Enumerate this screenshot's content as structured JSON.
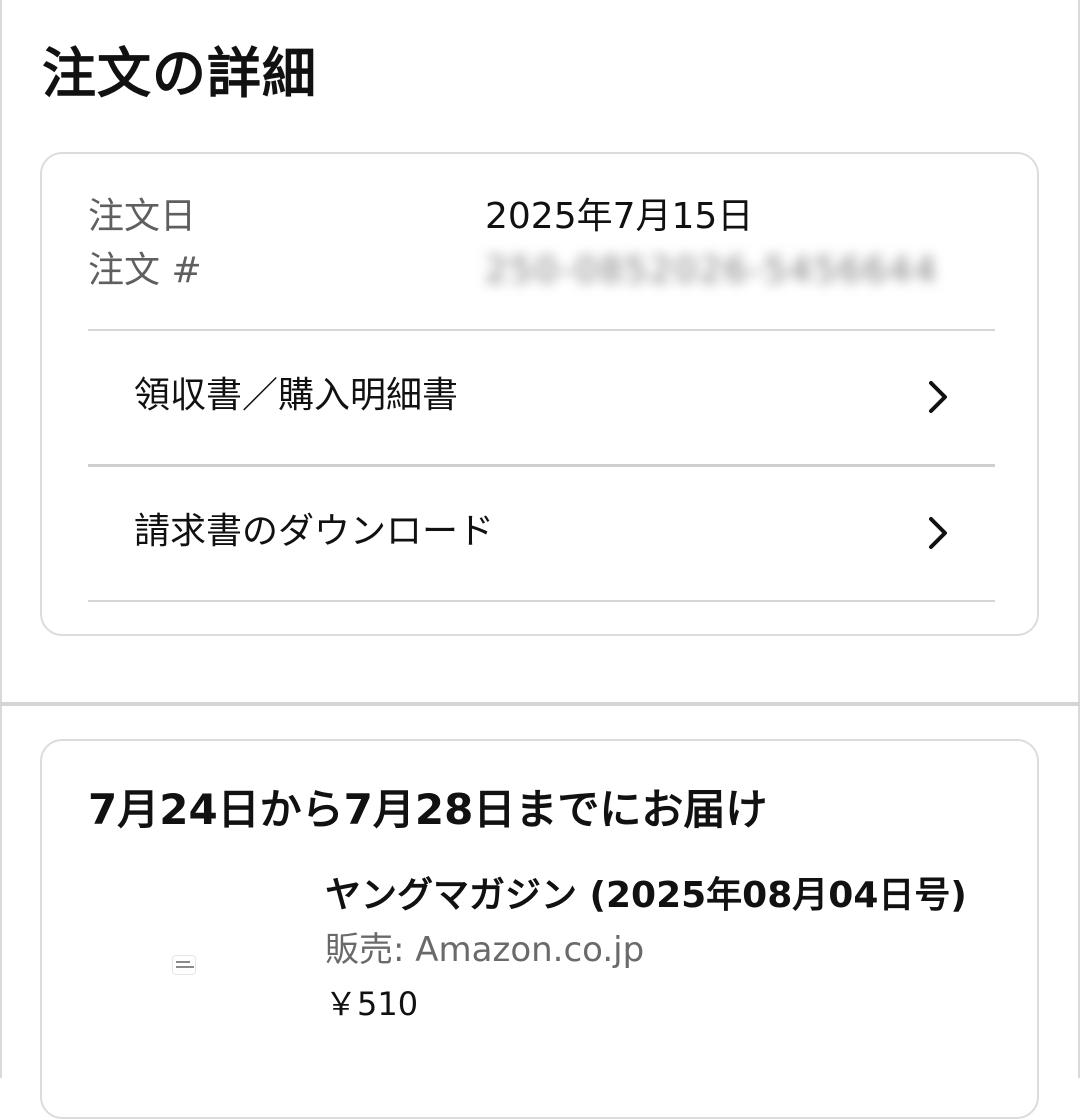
{
  "page": {
    "title": "注文の詳細"
  },
  "order_details": {
    "date_label": "注文日",
    "date_value": "2025年7月15日",
    "number_label": "注文 #",
    "number_value": "250-0852026-5456644"
  },
  "links": [
    {
      "label": "領収書／購入明細書",
      "icon": "chevron-right-icon"
    },
    {
      "label": "請求書のダウンロード",
      "icon": "chevron-right-icon"
    }
  ],
  "delivery": {
    "title": "7月24日から7月28日までにお届け",
    "product": {
      "name": "ヤングマガジン (2025年08月04日号)",
      "seller": "販売: Amazon.co.jp",
      "price": "￥510",
      "thumbnail_icon": "product-thumbnail"
    }
  },
  "colors": {
    "text_primary": "#111111",
    "text_secondary": "#5f5f5f",
    "border": "#dcdcdc",
    "background": "#ffffff"
  }
}
